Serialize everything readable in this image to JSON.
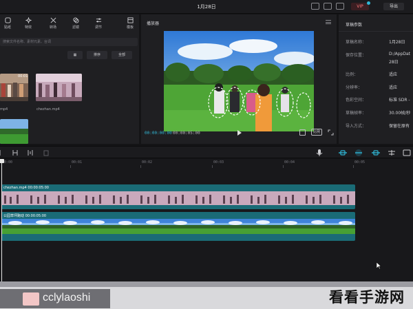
{
  "app": {
    "window_title": "1月28日"
  },
  "header": {
    "vip_label": "VIP",
    "share_label": "导出"
  },
  "media": {
    "tools": [
      {
        "label": "贴纸",
        "icon": "sticker-icon"
      },
      {
        "label": "特效",
        "icon": "effects-icon"
      },
      {
        "label": "转场",
        "icon": "transition-icon"
      },
      {
        "label": "滤镜",
        "icon": "filter-icon"
      },
      {
        "label": "调节",
        "icon": "adjust-icon"
      },
      {
        "label": "模板",
        "icon": "template-icon"
      }
    ],
    "search_placeholder": "搜索文件名称、素材元素、台词",
    "view_label": "▦",
    "sort_label": "排序",
    "all_label": "全部",
    "items": [
      {
        "name": "",
        "duration": "00:01"
      },
      {
        "name": "chezhan.mp4",
        "duration": ""
      },
      {
        "name": "",
        "duration": ""
      }
    ]
  },
  "player": {
    "title": "播放器",
    "current_time": "00:00:00:00",
    "total_time": "00:00:05:00",
    "ratio_label": "比例"
  },
  "draft": {
    "title": "草稿参数",
    "rows": [
      {
        "key": "草稿名称：",
        "value": "1月28日"
      },
      {
        "key": "保存位置：",
        "value": "D:/AppDat"
      },
      {
        "key": "",
        "value": "28日"
      },
      {
        "key": "比例：",
        "value": "适应"
      },
      {
        "key": "分辨率：",
        "value": "适应"
      },
      {
        "key": "色彩空间：",
        "value": "标准 SDR -"
      },
      {
        "key": "草稿帧率：",
        "value": "30.00帧/秒"
      },
      {
        "key": "导入方式：",
        "value": "保留在原有"
      }
    ]
  },
  "timeline": {
    "ruler": [
      "00:00",
      "00:01",
      "00:02",
      "00:03",
      "00:04",
      "00:05"
    ],
    "tracks": [
      {
        "label": "chezhan.mp4   00:00:05:00"
      },
      {
        "label": "公园草坪跑动   00:00:05:00"
      }
    ]
  },
  "watermark": {
    "left_text": "cclylaoshi",
    "right_text": "看看手游网"
  }
}
